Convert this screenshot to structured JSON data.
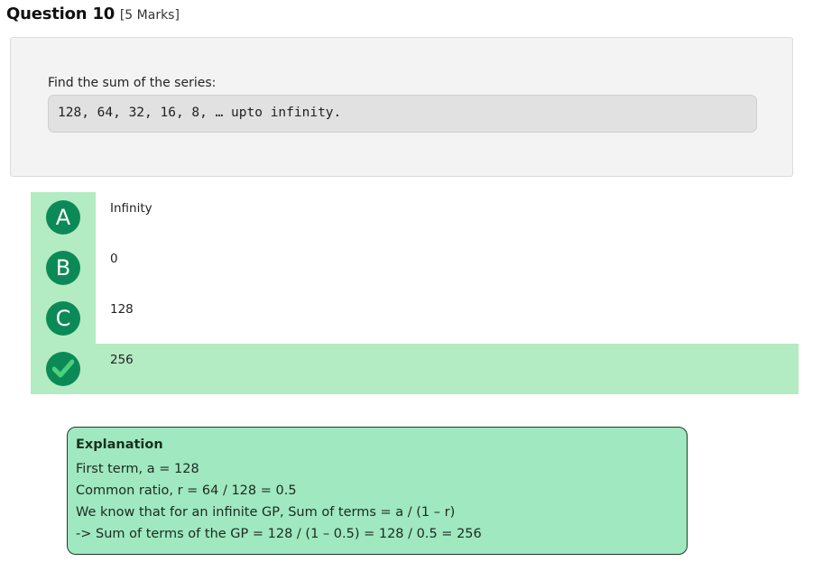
{
  "question": {
    "title": "Question 10",
    "marks": "[5 Marks]",
    "prompt": "Find the sum of the series:",
    "code": "128, 64, 32, 16, 8, … upto infinity."
  },
  "options": [
    {
      "letter": "A",
      "label": "Infinity",
      "correct": false
    },
    {
      "letter": "B",
      "label": "0",
      "correct": false
    },
    {
      "letter": "C",
      "label": "128",
      "correct": false
    },
    {
      "letter": "",
      "icon": "checkmark-icon",
      "label": "256",
      "correct": true
    }
  ],
  "explanation": {
    "title": "Explanation",
    "lines": [
      "First term, a = 128",
      "Common ratio, r = 64 / 128 = 0.5",
      "We know that for an infinite GP, Sum of terms = a / (1 – r)",
      "-> Sum of terms of the GP = 128 / (1 – 0.5) = 128 / 0.5 = 256"
    ]
  },
  "colors": {
    "accent": "#0b8a57",
    "correct_bg": "#b3ebc2",
    "explanation_bg": "#a0e8c0"
  }
}
